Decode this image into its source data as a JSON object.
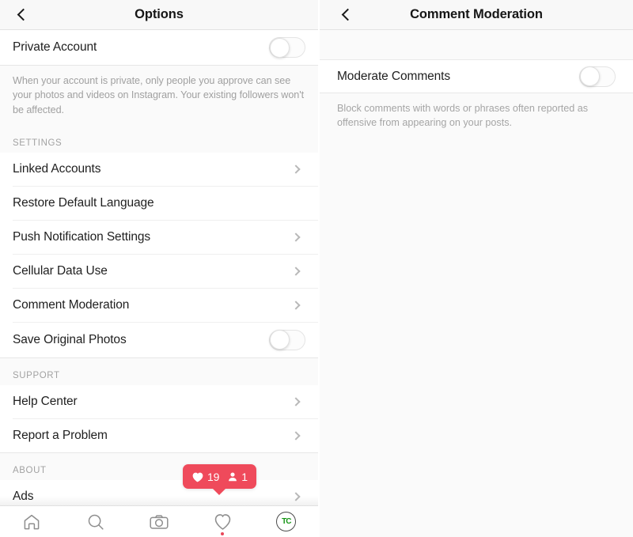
{
  "left_panel": {
    "header": {
      "back_icon": "chevron-left-icon",
      "title": "Options"
    },
    "private_account": {
      "label": "Private Account",
      "toggle_state": "off",
      "description": "When your account is private, only people you approve can see your photos and videos on Instagram. Your existing followers won't be affected."
    },
    "sections": [
      {
        "header": "SETTINGS",
        "items": [
          {
            "label": "Linked Accounts",
            "accessory": "chevron"
          },
          {
            "label": "Restore Default Language",
            "accessory": "none"
          },
          {
            "label": "Push Notification Settings",
            "accessory": "chevron"
          },
          {
            "label": "Cellular Data Use",
            "accessory": "chevron"
          },
          {
            "label": "Comment Moderation",
            "accessory": "chevron"
          },
          {
            "label": "Save Original Photos",
            "accessory": "toggle",
            "toggle_state": "off"
          }
        ]
      },
      {
        "header": "SUPPORT",
        "items": [
          {
            "label": "Help Center",
            "accessory": "chevron"
          },
          {
            "label": "Report a Problem",
            "accessory": "chevron"
          }
        ]
      },
      {
        "header": "ABOUT",
        "items": [
          {
            "label": "Ads",
            "accessory": "chevron"
          }
        ]
      }
    ],
    "notification_badge": {
      "like_icon": "heart-filled-icon",
      "like_count": "19",
      "follower_icon": "person-filled-icon",
      "follower_count": "1",
      "color": "#ef4a5b"
    },
    "tabbar": {
      "items": [
        {
          "name": "home-icon",
          "label": "Home"
        },
        {
          "name": "search-icon",
          "label": "Search"
        },
        {
          "name": "camera-icon",
          "label": "Camera"
        },
        {
          "name": "heart-icon",
          "label": "Activity",
          "has_dot": true
        },
        {
          "name": "profile-avatar",
          "label": "Profile",
          "avatar_text": "TC"
        }
      ]
    }
  },
  "right_panel": {
    "header": {
      "back_icon": "chevron-left-icon",
      "title": "Comment Moderation"
    },
    "moderate_comments": {
      "label": "Moderate Comments",
      "toggle_state": "off",
      "description": "Block comments with words or phrases often reported as offensive from appearing on your posts."
    }
  }
}
